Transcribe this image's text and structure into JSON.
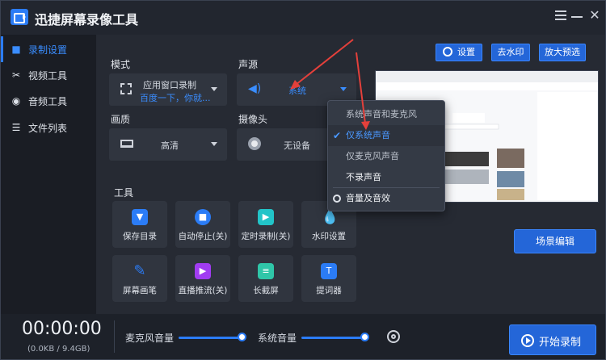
{
  "app": {
    "title": "迅捷屏幕录像工具"
  },
  "sidebar": {
    "items": [
      {
        "label": "录制设置",
        "icon": "camera-icon",
        "active": true
      },
      {
        "label": "视频工具",
        "icon": "video-tools-icon",
        "active": false
      },
      {
        "label": "音频工具",
        "icon": "audio-tools-icon",
        "active": false
      },
      {
        "label": "文件列表",
        "icon": "file-list-icon",
        "active": false
      }
    ]
  },
  "toolbar": {
    "settings_label": "设置",
    "remove_watermark_label": "去水印",
    "zoom_preview_label": "放大预选"
  },
  "settings": {
    "mode": {
      "label": "模式",
      "value_line1": "应用窗口录制",
      "value_line2": "百度一下，你就..."
    },
    "audio_source": {
      "label": "声源",
      "value": "系统"
    },
    "quality": {
      "label": "画质",
      "value": "高清"
    },
    "camera": {
      "label": "摄像头",
      "value": "无设备"
    }
  },
  "tools": {
    "label": "工具",
    "items": [
      {
        "label": "保存目录",
        "icon": "folder-icon",
        "color": "#2b7cf6"
      },
      {
        "label": "自动停止(关)",
        "icon": "auto-stop-icon",
        "color": "#2b7cf6"
      },
      {
        "label": "定时录制(关)",
        "icon": "timer-record-icon",
        "color": "#22c4c8"
      },
      {
        "label": "水印设置",
        "icon": "watermark-icon",
        "color": "#3a9cff"
      },
      {
        "label": "屏幕画笔",
        "icon": "pen-icon",
        "color": "#2b7cf6"
      },
      {
        "label": "直播推流(关)",
        "icon": "live-stream-icon",
        "color": "#a13cf2"
      },
      {
        "label": "长截屏",
        "icon": "long-screenshot-icon",
        "color": "#2fc6a8"
      },
      {
        "label": "提词器",
        "icon": "teleprompter-icon",
        "color": "#2b7cf6"
      }
    ]
  },
  "audio_dropdown": {
    "options": [
      {
        "label": "系统声音和麦克风",
        "selected": false
      },
      {
        "label": "仅系统声音",
        "selected": true
      },
      {
        "label": "仅麦克风声音",
        "selected": false
      },
      {
        "label": "不录声音",
        "selected": false
      }
    ],
    "footer_label": "音量及音效"
  },
  "scene_edit_label": "场景编辑",
  "bottom": {
    "timer": "00:00:00",
    "size": "(0.0KB / 9.4GB)",
    "mic_volume_label": "麦克风音量",
    "mic_volume": 1.0,
    "system_volume_label": "系统音量",
    "system_volume": 1.0,
    "start_label": "开始录制"
  },
  "colors": {
    "accent": "#2b7cf6",
    "annotation_arrow": "#e4403b"
  }
}
